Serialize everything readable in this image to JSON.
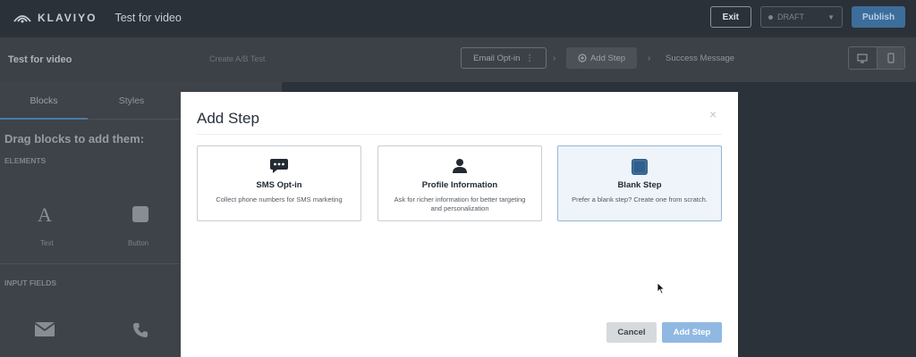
{
  "topbar": {
    "brand": "KLAVIYO",
    "title": "Test for video",
    "exit_label": "Exit",
    "status_label": "DRAFT",
    "publish_label": "Publish"
  },
  "subbar": {
    "form_name": "Test for video",
    "create_ab_label": "Create A/B Test",
    "steps": {
      "email_optin": "Email Opt-in",
      "add_step": "Add Step",
      "success_message": "Success Message"
    }
  },
  "left_panel": {
    "tabs": [
      "Blocks",
      "Styles"
    ],
    "active_tab": "Blocks",
    "hint": "Drag blocks to add them:",
    "elements_label": "ELEMENTS",
    "elements": [
      "Text",
      "Button"
    ],
    "input_fields_label": "INPUT FIELDS"
  },
  "modal": {
    "title": "Add Step",
    "close_glyph": "×",
    "cards": [
      {
        "title": "SMS Opt-in",
        "description": "Collect phone numbers for SMS marketing",
        "icon": "chat-bubble-icon",
        "selected": false
      },
      {
        "title": "Profile Information",
        "description": "Ask for richer information for better targeting and personalization",
        "icon": "person-icon",
        "selected": false
      },
      {
        "title": "Blank Step",
        "description": "Prefer a blank step? Create one from scratch.",
        "icon": "blank-square-icon",
        "selected": true
      }
    ],
    "cancel_label": "Cancel",
    "confirm_label": "Add Step"
  },
  "colors": {
    "accent": "#8fb9e2",
    "selected_card_bg": "#eef4fa",
    "backdrop": "#2c3239"
  }
}
